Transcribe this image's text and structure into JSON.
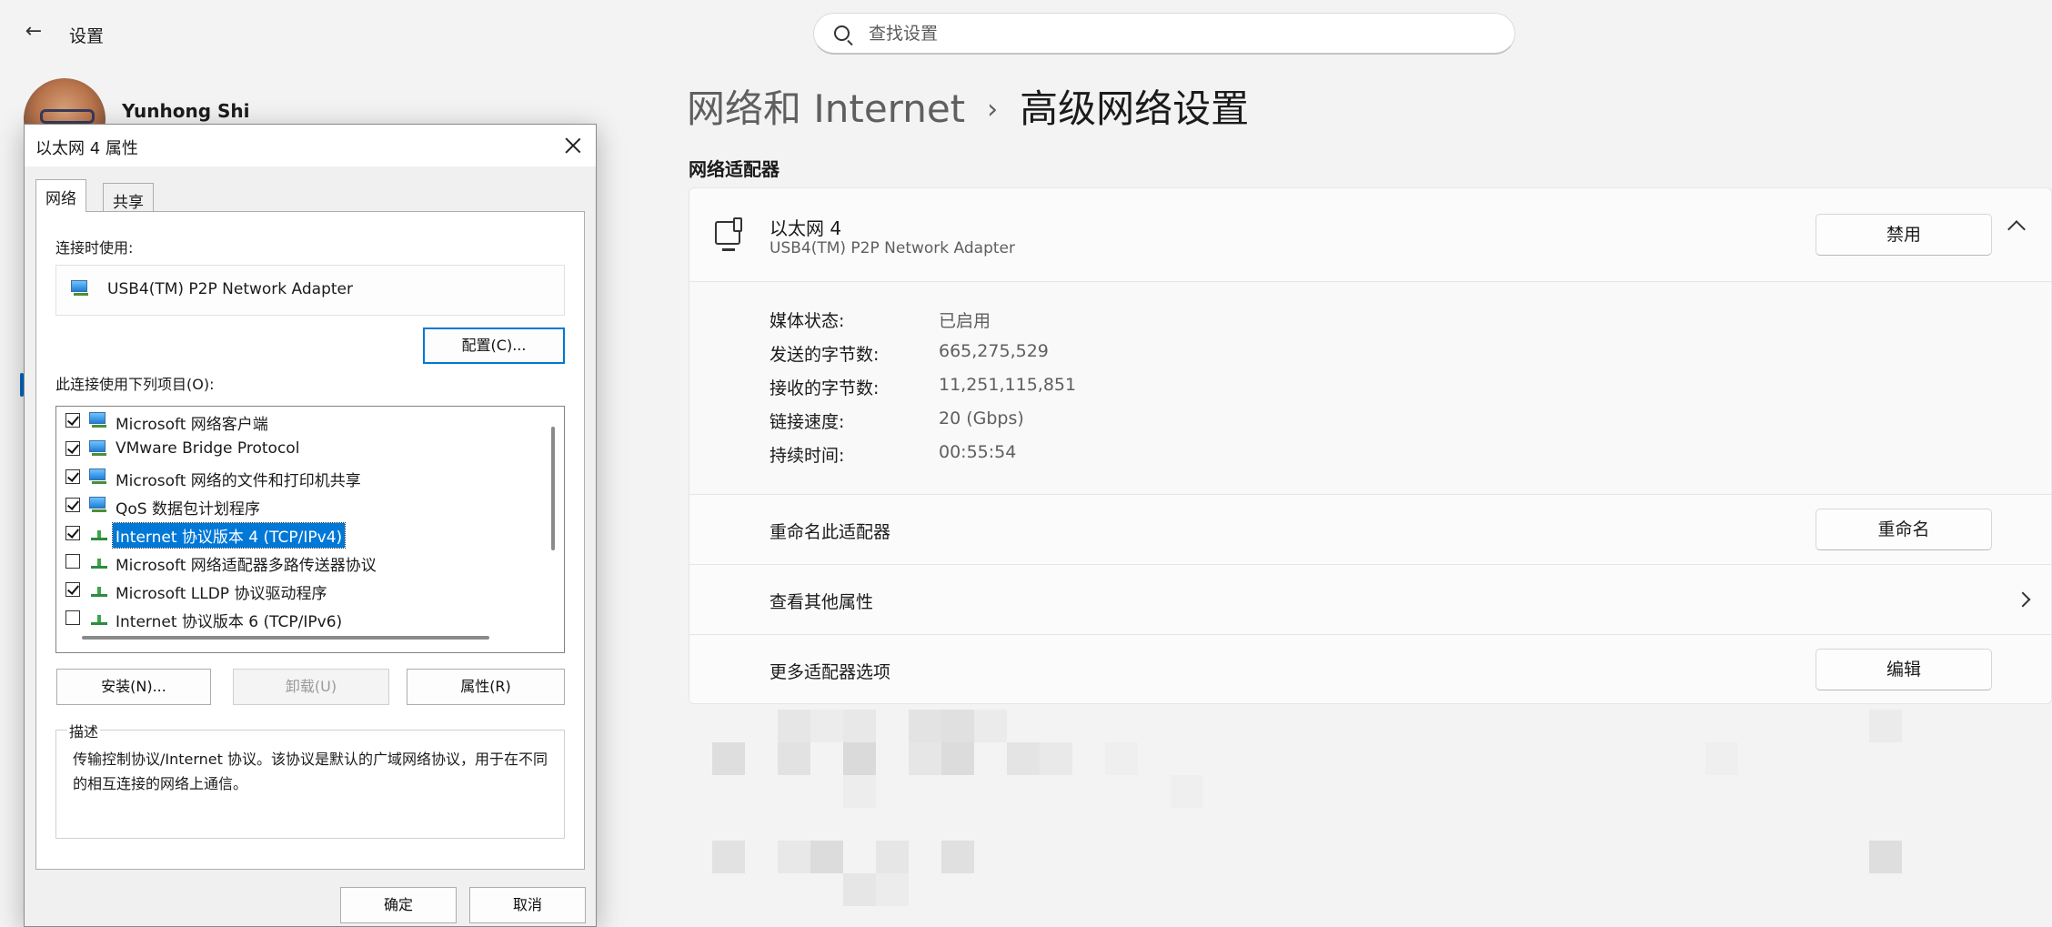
{
  "app": {
    "title": "设置"
  },
  "search": {
    "placeholder": "查找设置"
  },
  "user": {
    "name": "Yunhong Shi"
  },
  "breadcrumb": {
    "parent": "网络和 Internet",
    "separator": "›",
    "current": "高级网络设置"
  },
  "section_title": "网络适配器",
  "adapter": {
    "name": "以太网 4",
    "description": "USB4(TM) P2P Network Adapter",
    "disable_label": "禁用",
    "details": [
      {
        "key": "媒体状态:",
        "value": "已启用"
      },
      {
        "key": "发送的字节数:",
        "value": "665,275,529"
      },
      {
        "key": "接收的字节数:",
        "value": "11,251,115,851"
      },
      {
        "key": "链接速度:",
        "value": "20 (Gbps)"
      },
      {
        "key": "持续时间:",
        "value": "00:55:54"
      }
    ],
    "rename_row": {
      "label": "重命名此适配器",
      "button": "重命名"
    },
    "props_row": {
      "label": "查看其他属性"
    },
    "more_row": {
      "label": "更多适配器选项",
      "button": "编辑"
    }
  },
  "dialog": {
    "title": "以太网 4 属性",
    "tabs": [
      "网络",
      "共享"
    ],
    "connect_using_label": "连接时使用:",
    "adapter": "USB4(TM) P2P Network Adapter",
    "configure_label": "配置(C)...",
    "items_label": "此连接使用下列项目(O):",
    "items": [
      {
        "label": "Microsoft 网络客户端",
        "checked": true,
        "icon": "network-icon"
      },
      {
        "label": "VMware Bridge Protocol",
        "checked": true,
        "icon": "network-icon"
      },
      {
        "label": "Microsoft 网络的文件和打印机共享",
        "checked": true,
        "icon": "network-icon"
      },
      {
        "label": "QoS 数据包计划程序",
        "checked": true,
        "icon": "network-icon"
      },
      {
        "label": "Internet 协议版本 4 (TCP/IPv4)",
        "checked": true,
        "icon": "protocol-icon",
        "selected": true
      },
      {
        "label": "Microsoft 网络适配器多路传送器协议",
        "checked": false,
        "icon": "protocol-icon"
      },
      {
        "label": "Microsoft LLDP 协议驱动程序",
        "checked": true,
        "icon": "protocol-icon"
      },
      {
        "label": "Internet 协议版本 6 (TCP/IPv6)",
        "checked": false,
        "icon": "protocol-icon"
      }
    ],
    "install_label": "安装(N)...",
    "uninstall_label": "卸载(U)",
    "properties_label": "属性(R)",
    "description_legend": "描述",
    "description_text": "传输控制协议/Internet 协议。该协议是默认的广域网络协议，用于在不同的相互连接的网络上通信。",
    "ok_label": "确定",
    "cancel_label": "取消"
  },
  "colors": {
    "accent": "#0067c0",
    "selection": "#0078d7",
    "focus_border": "#0078d4"
  }
}
